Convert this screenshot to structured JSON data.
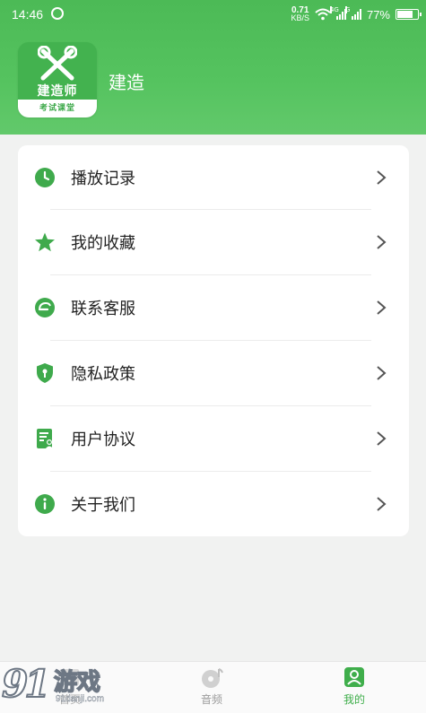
{
  "status_bar": {
    "time": "14:46",
    "net_speed_value": "0.71",
    "net_speed_unit": "KB/S",
    "signal1_tag": "4G",
    "signal2_tag": "G",
    "battery_percent": "77%",
    "battery_level": 0.77
  },
  "header": {
    "logo_name": "建造师",
    "logo_tagline": "考试课堂",
    "app_title": "建造"
  },
  "menu": {
    "items": [
      {
        "label": "播放记录",
        "icon": "clock-icon"
      },
      {
        "label": "我的收藏",
        "icon": "star-icon"
      },
      {
        "label": "联系客服",
        "icon": "chat-icon"
      },
      {
        "label": "隐私政策",
        "icon": "shield-lock-icon"
      },
      {
        "label": "用户协议",
        "icon": "document-user-icon"
      },
      {
        "label": "关于我们",
        "icon": "info-icon"
      }
    ]
  },
  "tabbar": {
    "tabs": [
      {
        "label": "首页",
        "icon": "home-icon"
      },
      {
        "label": "音频",
        "icon": "music-disc-icon"
      },
      {
        "label": "我的",
        "icon": "profile-icon",
        "active": true
      }
    ]
  },
  "watermark": {
    "brand_number": "91",
    "brand_text": "游戏",
    "url": "91danji.com"
  },
  "colors": {
    "accent": "#4cba56",
    "icon_green": "#3faa4c",
    "active_tab": "#3fae4b",
    "inactive_tab": "#9b9b9b"
  }
}
